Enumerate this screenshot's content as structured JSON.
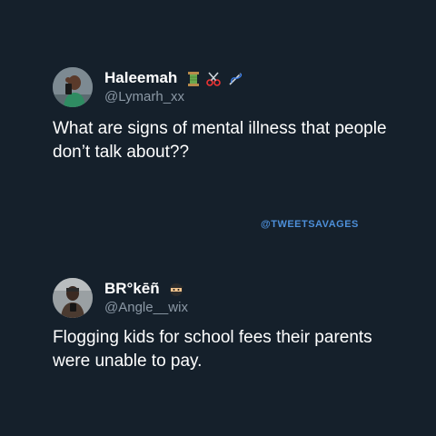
{
  "tweets": [
    {
      "display_name": "Haleemah",
      "name_emojis": [
        "thread-spool-icon",
        "scissors-icon",
        "sewing-needle-icon"
      ],
      "handle": "@Lymarh_xx",
      "text": "What are signs of mental illness that people don’t talk about??"
    },
    {
      "display_name": "BR°kēñ",
      "name_emojis": [
        "ninja-face-icon"
      ],
      "handle": "@Angle__wix",
      "text": "Flogging kids for school fees their parents were unable to pay."
    }
  ],
  "watermark": "@TWEETSAVAGES",
  "colors": {
    "background": "#15202b",
    "primary_text": "#ffffff",
    "secondary_text": "#8b98a5",
    "watermark": "#4d8fd9"
  }
}
